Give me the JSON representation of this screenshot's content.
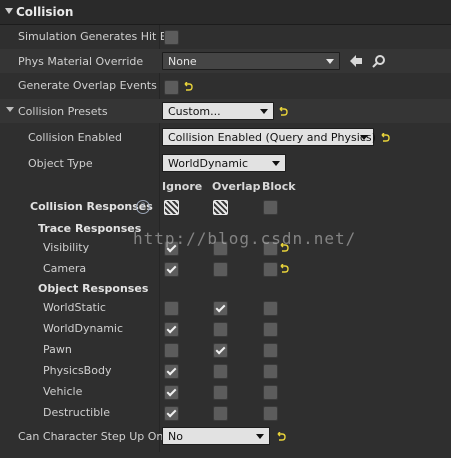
{
  "section": {
    "title": "Collision"
  },
  "rows": {
    "sim_hit": {
      "label": "Simulation Generates Hit Ev"
    },
    "phys_mat": {
      "label": "Phys Material Override",
      "value": "None"
    },
    "overlap": {
      "label": "Generate Overlap Events"
    },
    "presets": {
      "label": "Collision Presets",
      "value": "Custom..."
    },
    "enabled": {
      "label": "Collision Enabled",
      "value": "Collision Enabled (Query and Physics)"
    },
    "obj_type": {
      "label": "Object Type",
      "value": "WorldDynamic"
    },
    "step_up": {
      "label": "Can Character Step Up On",
      "value": "No"
    }
  },
  "columns": {
    "ignore": "Ignore",
    "overlap": "Overlap",
    "block": "Block"
  },
  "responses": {
    "label": "Collision Responses",
    "help": "?"
  },
  "trace": {
    "title": "Trace Responses",
    "items": [
      {
        "label": "Visibility",
        "ignore": true,
        "overlap": false,
        "block": false,
        "reset": true
      },
      {
        "label": "Camera",
        "ignore": true,
        "overlap": false,
        "block": false,
        "reset": true
      }
    ]
  },
  "object": {
    "title": "Object Responses",
    "items": [
      {
        "label": "WorldStatic",
        "ignore": false,
        "overlap": true,
        "block": false
      },
      {
        "label": "WorldDynamic",
        "ignore": true,
        "overlap": false,
        "block": false
      },
      {
        "label": "Pawn",
        "ignore": false,
        "overlap": true,
        "block": false
      },
      {
        "label": "PhysicsBody",
        "ignore": true,
        "overlap": false,
        "block": false
      },
      {
        "label": "Vehicle",
        "ignore": true,
        "overlap": false,
        "block": false
      },
      {
        "label": "Destructible",
        "ignore": true,
        "overlap": false,
        "block": false
      }
    ]
  },
  "watermark": "http://blog.csdn.net/",
  "icons": [
    "collapse-arrow-icon",
    "use-selected-arrow-icon",
    "browse-magnifier-icon",
    "reset-to-default-icon",
    "help-icon"
  ],
  "colors": {
    "panel": "#2f2f2f",
    "header": "#2a2a2a",
    "checkbox": "#5c5c5c",
    "reset": "#e8d33a"
  }
}
